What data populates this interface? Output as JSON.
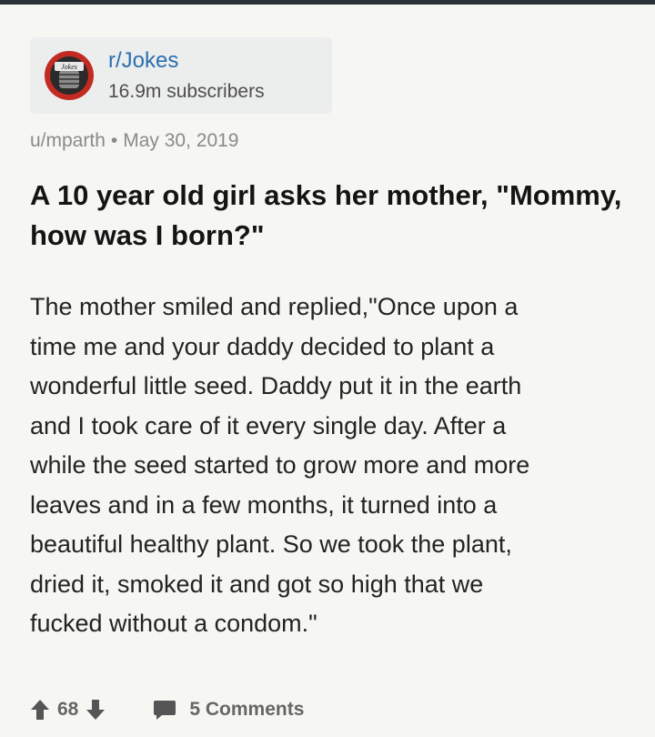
{
  "subreddit": {
    "name": "r/Jokes",
    "subscribers": "16.9m subscribers",
    "avatar_text": "Jokes"
  },
  "post": {
    "author": "u/mparth",
    "separator": "•",
    "date": "May 30, 2019",
    "title": "A 10 year old girl asks her mother, \"Mommy, how was I born?\"",
    "body_lines": [
      "The mother smiled and replied,\"Once upon a",
      "time me and your daddy decided to plant a",
      "wonderful little seed. Daddy put it in the earth",
      "and I took care of it every single day. After a",
      "while the seed started to grow more and more",
      "leaves and in a few months, it turned into a",
      "beautiful healthy plant. So we took the plant,",
      "dried it, smoked it and got so high that we",
      "fucked without a condom.\""
    ]
  },
  "footer": {
    "score": "68",
    "comments": "5 Comments"
  },
  "colors": {
    "link": "#2a6fb0",
    "background": "#f6f6f3",
    "card": "#eceded",
    "icon": "#555555"
  },
  "icons": {
    "upvote": "arrow-up-icon",
    "downvote": "arrow-down-icon",
    "comments": "comment-bubble-icon",
    "avatar": "microphone-logo"
  }
}
